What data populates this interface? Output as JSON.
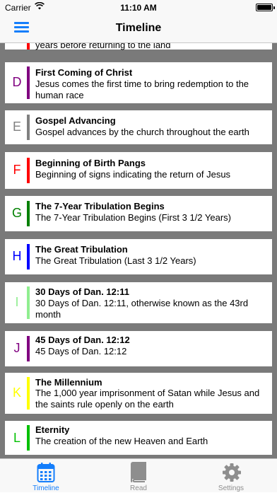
{
  "status": {
    "carrier": "Carrier",
    "time": "11:10 AM"
  },
  "nav": {
    "title": "Timeline"
  },
  "partial_item": {
    "desc": "years before returning to the land",
    "color": "#ff0000"
  },
  "items": [
    {
      "letter": "D",
      "color": "#800080",
      "title": "First Coming of Christ",
      "desc": "Jesus comes the first time to bring redemption to the human race"
    },
    {
      "letter": "E",
      "color": "#808080",
      "title": "Gospel Advancing",
      "desc": "Gospel advances by the church throughout the earth"
    },
    {
      "letter": "F",
      "color": "#ff0000",
      "title": "Beginning of Birth Pangs",
      "desc": "Beginning of signs indicating the return of Jesus"
    },
    {
      "letter": "G",
      "color": "#008000",
      "title": "The 7-Year Tribulation Begins",
      "desc": "The 7-Year Tribulation Begins (First 3 1/2 Years)"
    },
    {
      "letter": "H",
      "color": "#0000ff",
      "title": "The Great Tribulation",
      "desc": "The Great Tribulation (Last 3 1/2 Years)"
    },
    {
      "letter": "I",
      "color": "#90ee90",
      "title": "30 Days of Dan. 12:11",
      "desc": "30 Days of Dan. 12:11, otherwise known as the 43rd month"
    },
    {
      "letter": "J",
      "color": "#800080",
      "title": "45 Days of Dan. 12:12",
      "desc": "45 Days of Dan. 12:12"
    },
    {
      "letter": "K",
      "color": "#ffff00",
      "title": "The Millennium",
      "desc": "The 1,000 year imprisonment of Satan while Jesus and the saints rule openly on the earth"
    },
    {
      "letter": "L",
      "color": "#00c000",
      "title": "Eternity",
      "desc": "The creation of the new Heaven and Earth"
    }
  ],
  "tabs": [
    {
      "label": "Timeline",
      "icon": "calendar-icon",
      "active": true
    },
    {
      "label": "Read",
      "icon": "book-icon",
      "active": false
    },
    {
      "label": "Settings",
      "icon": "gear-icon",
      "active": false
    }
  ],
  "colors": {
    "accent": "#147efb",
    "inactive": "#8e8e8e",
    "list_bg": "#7a7a7a"
  }
}
